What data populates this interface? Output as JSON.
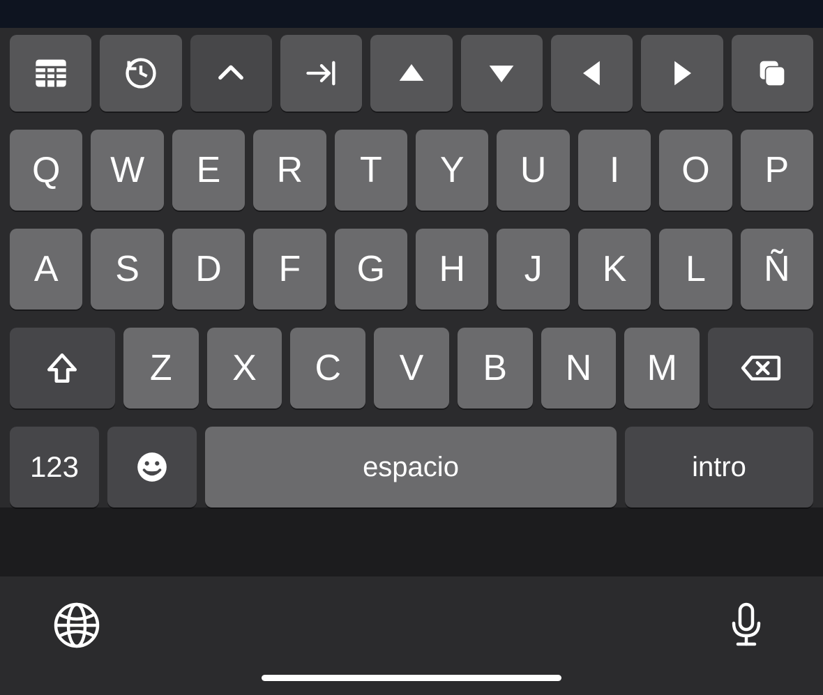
{
  "function_row": {
    "grid": "grid-icon",
    "history": "history-icon",
    "chevron_up": "chevron-up-icon",
    "tab": "tab-right-icon",
    "up": "triangle-up-icon",
    "down": "triangle-down-icon",
    "left": "triangle-left-icon",
    "right": "triangle-right-icon",
    "copy": "copy-icon"
  },
  "rows": {
    "r1": [
      "Q",
      "W",
      "E",
      "R",
      "T",
      "Y",
      "U",
      "I",
      "O",
      "P"
    ],
    "r2": [
      "A",
      "S",
      "D",
      "F",
      "G",
      "H",
      "J",
      "K",
      "L",
      "Ñ"
    ],
    "r3": [
      "Z",
      "X",
      "C",
      "V",
      "B",
      "N",
      "M"
    ]
  },
  "special": {
    "shift": "shift-icon",
    "backspace": "backspace-icon",
    "numbers_label": "123",
    "emoji": "emoji-icon",
    "space_label": "espacio",
    "return_label": "intro"
  },
  "footer": {
    "globe": "globe-icon",
    "mic": "mic-icon"
  }
}
